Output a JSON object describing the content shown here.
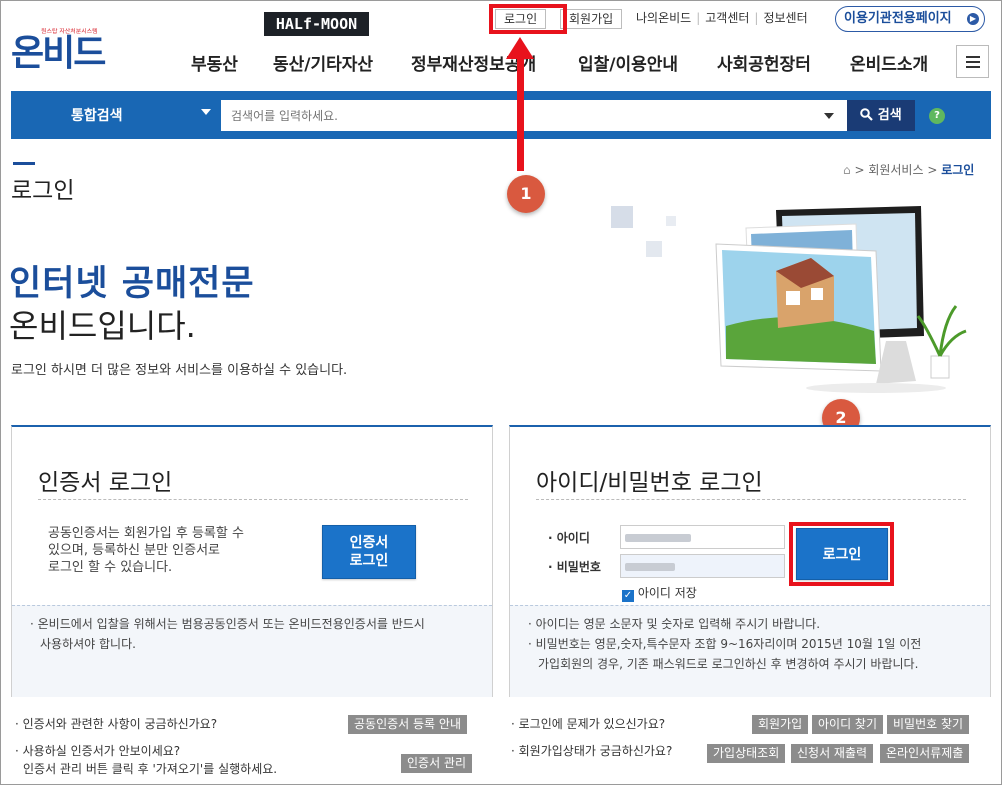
{
  "header": {
    "logo_tag": "원스탑 자산처분시스템",
    "logo_text": "온비드",
    "watermark": "HALf-MOON",
    "login_link": "로그인",
    "join_link": "회원가입",
    "my_onbid": "나의온비드",
    "customer_center": "고객센터",
    "info_center": "정보센터",
    "agency_page": "이용기관전용페이지",
    "nav": [
      "부동산",
      "동산/기타자산",
      "정부재산정보공개",
      "입찰/이용안내",
      "사회공헌장터",
      "온비드소개"
    ]
  },
  "search": {
    "category": "통합검색",
    "placeholder": "검색어를 입력하세요.",
    "button_label": "검색",
    "help": "?"
  },
  "page": {
    "title": "로그인",
    "breadcrumb": [
      "회원서비스",
      "로그인"
    ],
    "headline1": "인터넷 공매전문",
    "headline2": "온비드입니다.",
    "intro": "로그인 하시면 더 많은 정보와 서비스를 이용하실 수 있습니다."
  },
  "markers": [
    "1",
    "2"
  ],
  "cert_panel": {
    "title": "인증서 로그인",
    "desc": [
      "공동인증서는 회원가입 후 등록할 수",
      "있으며, 등록하신 분만 인증서로",
      "로그인 할 수 있습니다."
    ],
    "button": [
      "인증서",
      "로그인"
    ],
    "notice": [
      "온비드에서 입찰을 위해서는 범용공동인증서 또는 온비드전용인증서를 반드시",
      "사용하셔야 합니다."
    ]
  },
  "id_panel": {
    "title": "아이디/비밀번호 로그인",
    "id_label": "아이디",
    "pw_label": "비밀번호",
    "save_id": "아이디 저장",
    "save_id_checked": true,
    "button": "로그인",
    "notice1": "아이디는 영문 소문자 및 숫자로 입력해 주시기 바랍니다.",
    "notice2": [
      "비밀번호는 영문,숫자,특수문자 조합 9~16자리이며 2015년 10월 1일 이전",
      "가입회원의 경우, 기존 패스워드로 로그인하신 후 변경하여 주시기 바랍니다."
    ]
  },
  "help_left": {
    "q1": "인증서와 관련한 사항이 궁금하신가요?",
    "b1": "공동인증서 등록 안내",
    "q2": "사용하실 인증서가 안보이세요?",
    "q2_sub": "인증서 관리 버튼 클릭 후 '가져오기'를 실행하세요.",
    "b2": "인증서 관리"
  },
  "help_right": {
    "q1": "로그인에 문제가 있으신가요?",
    "b1": [
      "회원가입",
      "아이디 찾기",
      "비밀번호 찾기"
    ],
    "q2": "회원가입상태가 궁금하신가요?",
    "b2": [
      "가입상태조회",
      "신청서 재출력",
      "온라인서류제출"
    ]
  },
  "colors": {
    "brand": "#1b4e9b",
    "searchbar": "#1967b4",
    "highlight": "#e8121c",
    "marker": "#d9593f"
  }
}
